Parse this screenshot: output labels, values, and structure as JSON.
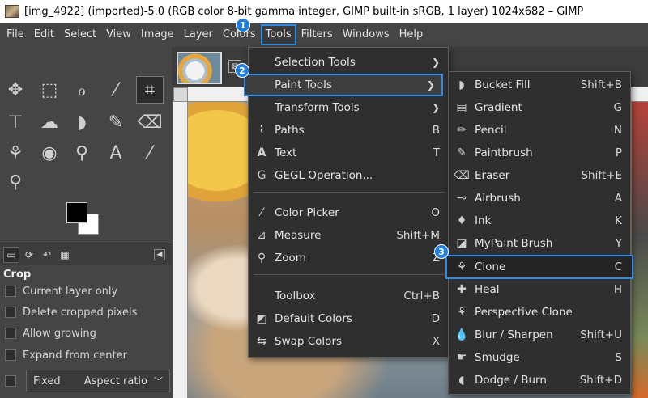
{
  "window": {
    "title": "[img_4922] (imported)-5.0 (RGB color 8-bit gamma integer, GIMP built-in sRGB, 1 layer) 1024x682 – GIMP"
  },
  "menubar": {
    "items": [
      "File",
      "Edit",
      "Select",
      "View",
      "Image",
      "Layer",
      "Colors",
      "Tools",
      "Filters",
      "Windows",
      "Help"
    ]
  },
  "badges": [
    "1",
    "2",
    "3"
  ],
  "tools_menu": {
    "items": [
      {
        "label": "Selection Tools",
        "shortcut": "",
        "submenu": true,
        "icon": ""
      },
      {
        "label": "Paint Tools",
        "shortcut": "",
        "submenu": true,
        "icon": ""
      },
      {
        "label": "Transform Tools",
        "shortcut": "",
        "submenu": true,
        "icon": ""
      },
      {
        "label": "Paths",
        "shortcut": "B",
        "icon": "paths-icon"
      },
      {
        "label": "Text",
        "shortcut": "T",
        "icon": "text-icon"
      },
      {
        "label": "GEGL Operation...",
        "shortcut": "",
        "icon": "gegl-icon"
      },
      {
        "label": "Color Picker",
        "shortcut": "O",
        "icon": "color-picker-icon"
      },
      {
        "label": "Measure",
        "shortcut": "Shift+M",
        "icon": "measure-icon"
      },
      {
        "label": "Zoom",
        "shortcut": "Z",
        "icon": "zoom-icon"
      },
      {
        "label": "Toolbox",
        "shortcut": "Ctrl+B",
        "icon": ""
      },
      {
        "label": "Default Colors",
        "shortcut": "D",
        "icon": "default-colors-icon"
      },
      {
        "label": "Swap Colors",
        "shortcut": "X",
        "icon": "swap-colors-icon"
      }
    ]
  },
  "paint_menu": {
    "items": [
      {
        "label": "Bucket Fill",
        "shortcut": "Shift+B",
        "icon": "bucket-fill-icon"
      },
      {
        "label": "Gradient",
        "shortcut": "G",
        "icon": "gradient-icon"
      },
      {
        "label": "Pencil",
        "shortcut": "N",
        "icon": "pencil-icon"
      },
      {
        "label": "Paintbrush",
        "shortcut": "P",
        "icon": "paintbrush-icon"
      },
      {
        "label": "Eraser",
        "shortcut": "Shift+E",
        "icon": "eraser-icon"
      },
      {
        "label": "Airbrush",
        "shortcut": "A",
        "icon": "airbrush-icon"
      },
      {
        "label": "Ink",
        "shortcut": "K",
        "icon": "ink-icon"
      },
      {
        "label": "MyPaint Brush",
        "shortcut": "Y",
        "icon": "mypaint-brush-icon"
      },
      {
        "label": "Clone",
        "shortcut": "C",
        "icon": "clone-icon"
      },
      {
        "label": "Heal",
        "shortcut": "H",
        "icon": "heal-icon"
      },
      {
        "label": "Perspective Clone",
        "shortcut": "",
        "icon": "perspective-clone-icon"
      },
      {
        "label": "Blur / Sharpen",
        "shortcut": "Shift+U",
        "icon": "blur-sharpen-icon"
      },
      {
        "label": "Smudge",
        "shortcut": "S",
        "icon": "smudge-icon"
      },
      {
        "label": "Dodge / Burn",
        "shortcut": "Shift+D",
        "icon": "dodge-burn-icon"
      }
    ]
  },
  "tool_options": {
    "title": "Crop",
    "options": [
      "Current layer only",
      "Delete cropped pixels",
      "Allow growing",
      "Expand from center"
    ],
    "fixed_label": "Fixed",
    "fixed_value": "Aspect ratio"
  },
  "colors": {
    "accent": "#2f8ce6",
    "menu_bg": "#2f2f2f",
    "ui_bg": "#454545"
  }
}
